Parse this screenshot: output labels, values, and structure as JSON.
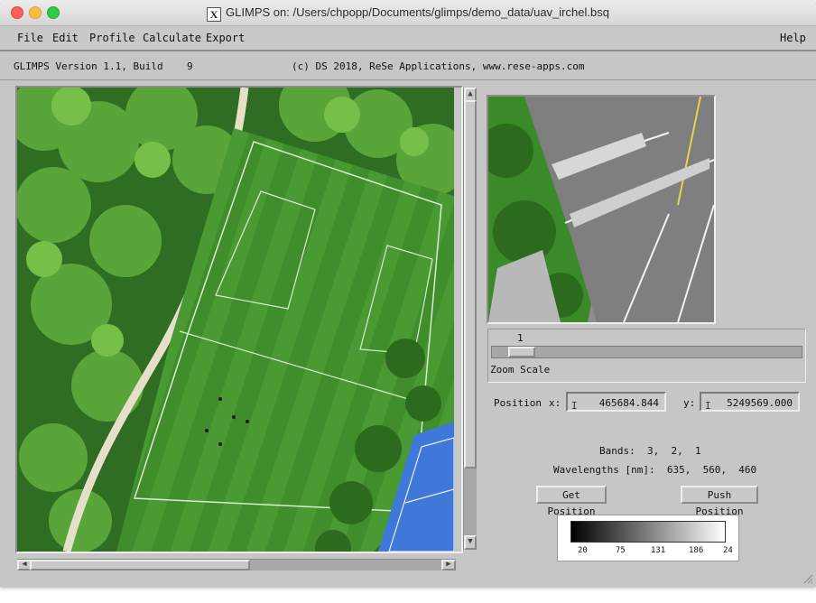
{
  "window": {
    "title": "GLIMPS on: /Users/chpopp/Documents/glimps/demo_data/uav_irchel.bsq",
    "title_icon": "X"
  },
  "menu": {
    "items": [
      "File",
      "Edit",
      "Profile",
      "Calculate",
      "Export"
    ],
    "help": "Help"
  },
  "info": {
    "version": "GLIMPS Version 1.1, Build    9",
    "copyright": "(c) DS 2018, ReSe Applications, www.rese-apps.com"
  },
  "zoom": {
    "value": "1",
    "label": "Zoom Scale"
  },
  "position": {
    "label": "Position",
    "x_label": "x:",
    "x_value": "465684.844",
    "y_label": "y:",
    "y_value": "5249569.000"
  },
  "bands": {
    "bands_text": "Bands:  3,  2,  1",
    "wavelengths_text": "Wavelengths [nm]:  635,  560,  460"
  },
  "buttons": {
    "get_position": "Get Position",
    "push_position": "Push Position"
  },
  "colorbar": {
    "ticks": [
      "20",
      "75",
      "131",
      "186",
      "24"
    ]
  },
  "icons": {
    "close": "close-icon",
    "minimize": "minimize-icon",
    "zoom": "zoom-icon",
    "x11": "x11-icon",
    "arrow_up": "arrow-up-icon",
    "arrow_down": "arrow-down-icon",
    "arrow_left": "arrow-left-icon",
    "arrow_right": "arrow-right-icon",
    "resize": "resize-grip-icon"
  },
  "colors": {
    "background": "#c6c6c6",
    "grass": "#3f8f2a",
    "tennis_court": "#3f78d8"
  }
}
